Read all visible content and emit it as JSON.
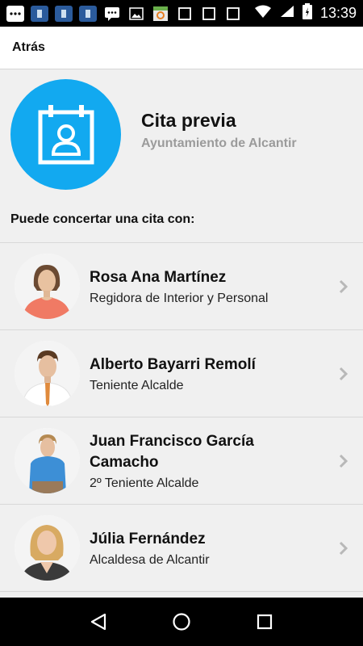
{
  "status_bar": {
    "time": "13:39",
    "icons": [
      "messages-icon",
      "app-icon",
      "app-icon",
      "app-icon",
      "chat-icon",
      "image-icon",
      "calendar-icon",
      "checkbox-icon",
      "checkbox-icon",
      "checkbox-icon",
      "wifi-icon",
      "signal-icon",
      "battery-icon"
    ]
  },
  "header": {
    "back_label": "Atrás"
  },
  "hero": {
    "title": "Cita previa",
    "subtitle": "Ayuntamiento de Alcantir",
    "icon": "calendar-person-icon",
    "color": "#12a9f0"
  },
  "intro_text": "Puede concertar una cita con:",
  "contacts": [
    {
      "name": "Rosa Ana Martínez",
      "role": "Regidora de Interior y Personal"
    },
    {
      "name": "Alberto Bayarri Remolí",
      "role": "Teniente Alcalde"
    },
    {
      "name": "Juan Francisco García Camacho",
      "role": "2º Teniente Alcalde"
    },
    {
      "name": "Júlia Fernández",
      "role": "Alcaldesa de Alcantir"
    }
  ],
  "nav_bar": {
    "icons": [
      "back-icon",
      "home-icon",
      "recents-icon"
    ]
  }
}
